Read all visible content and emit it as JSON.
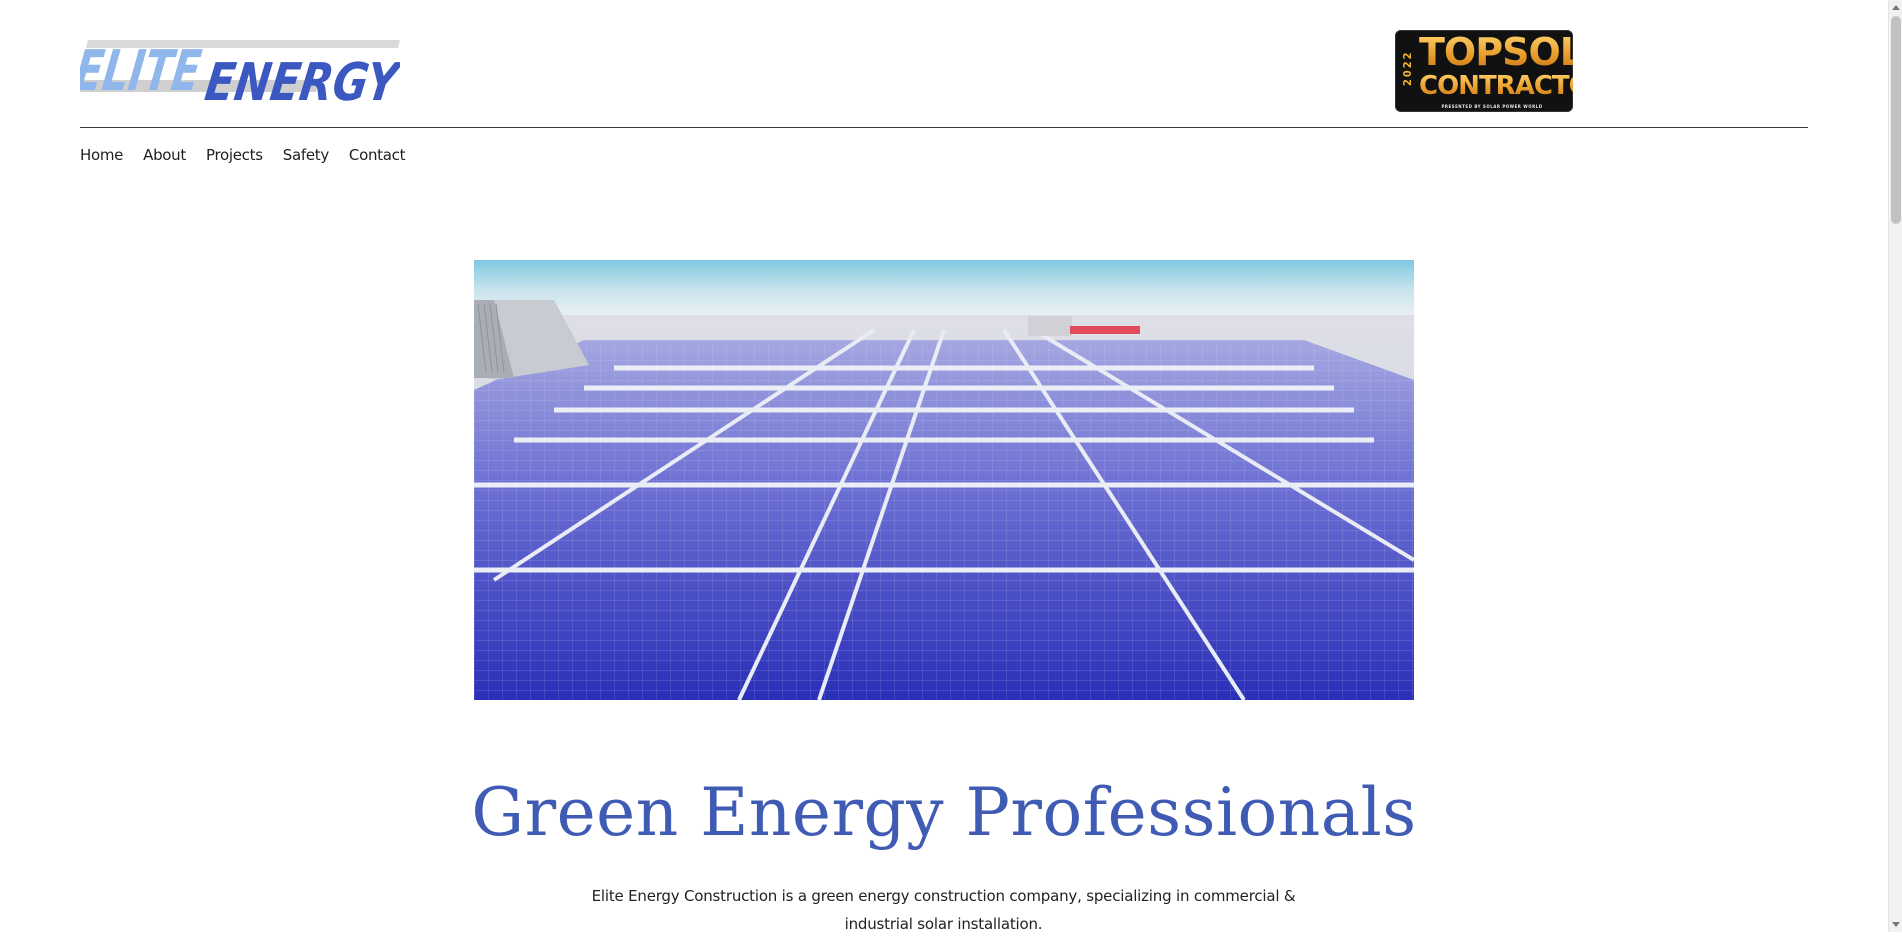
{
  "header": {
    "logo": {
      "part1": "ELITE",
      "part2": "ENERGY",
      "icon": "elite-energy-logo"
    },
    "badge": {
      "year": "2022",
      "line1": "TOPSOLAR",
      "line2": "CONTRACTORS",
      "subtitle": "PRESENTED BY SOLAR POWER WORLD"
    }
  },
  "nav": {
    "items": [
      {
        "label": "Home"
      },
      {
        "label": "About"
      },
      {
        "label": "Projects"
      },
      {
        "label": "Safety"
      },
      {
        "label": "Contact"
      }
    ]
  },
  "main": {
    "hero_image": "solar-panel-array-on-rooftop",
    "headline": "Green Energy Professionals",
    "description": "Elite Energy Construction is a green energy construction company, specializing in commercial & industrial solar installation."
  },
  "colors": {
    "accent": "#3f5bb4",
    "logo_light": "#8fb7ec",
    "logo_dark": "#3b57c0",
    "badge_gold": "#f2b233"
  }
}
